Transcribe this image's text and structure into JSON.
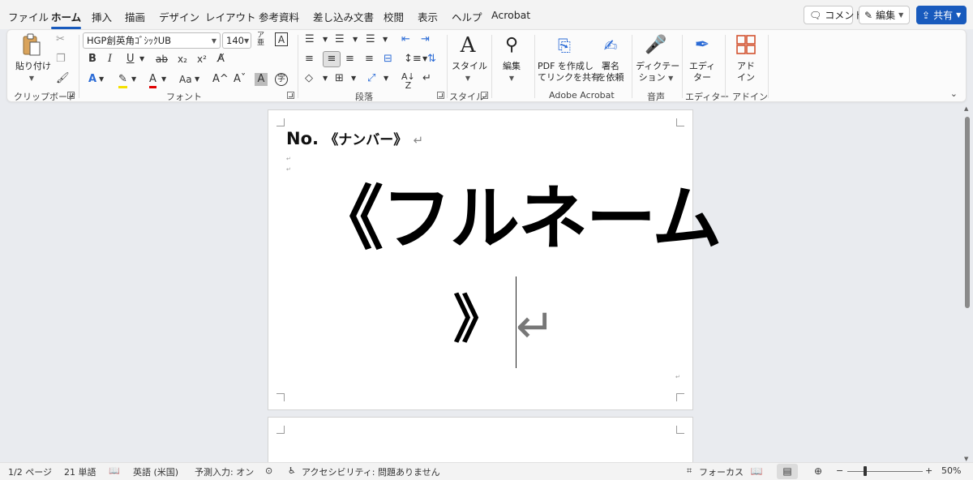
{
  "menu": {
    "tabs": [
      "ファイル",
      "ホーム",
      "挿入",
      "描画",
      "デザイン",
      "レイアウト",
      "参考資料",
      "差し込み文書",
      "校閲",
      "表示",
      "ヘルプ",
      "Acrobat"
    ],
    "comment_label": "コメント",
    "edit_label": "編集",
    "share_label": "共有"
  },
  "ribbon": {
    "clipboard": {
      "paste_label": "貼り付け",
      "group_label": "クリップボード"
    },
    "font": {
      "font_name": "HGP創英角ｺﾞｼｯｸUB",
      "font_size": "140",
      "bold": "B",
      "italic": "I",
      "underline": "U",
      "strike": "ab",
      "subscript": "x₂",
      "superscript": "x²",
      "change_case": "Aa",
      "grow": "A^",
      "shrink": "Aˇ",
      "group_label": "フォント"
    },
    "paragraph": {
      "group_label": "段落"
    },
    "styles": {
      "label": "スタイル",
      "group_label": "スタイル"
    },
    "editing": {
      "label": "編集"
    },
    "acrobat": {
      "pdf_share_line1": "PDF を作成し",
      "pdf_share_line2": "てリンクを共有",
      "sign_line1": "署名",
      "sign_line2": "を依頼",
      "group_label": "Adobe Acrobat"
    },
    "voice": {
      "dictate_line1": "ディクテー",
      "dictate_line2": "ション",
      "group_label": "音声"
    },
    "editor": {
      "line1": "エディ",
      "line2": "ター",
      "group_label": "エディター"
    },
    "addins": {
      "line1": "アド",
      "line2": "イン",
      "group_label": "アドイン"
    }
  },
  "document": {
    "number_prefix": "No.",
    "number_field": "《ナンバー》",
    "fullname_line1": "《フルネーム",
    "fullname_line2": "》",
    "para_mark": "↵"
  },
  "status": {
    "page": "1/2 ページ",
    "words": "21 単語",
    "language": "英語 (米国)",
    "predict": "予測入力: オン",
    "accessibility": "アクセシビリティ: 問題ありません",
    "focus": "フォーカス",
    "zoom": "50%",
    "zoom_minus": "−",
    "zoom_plus": "+"
  }
}
